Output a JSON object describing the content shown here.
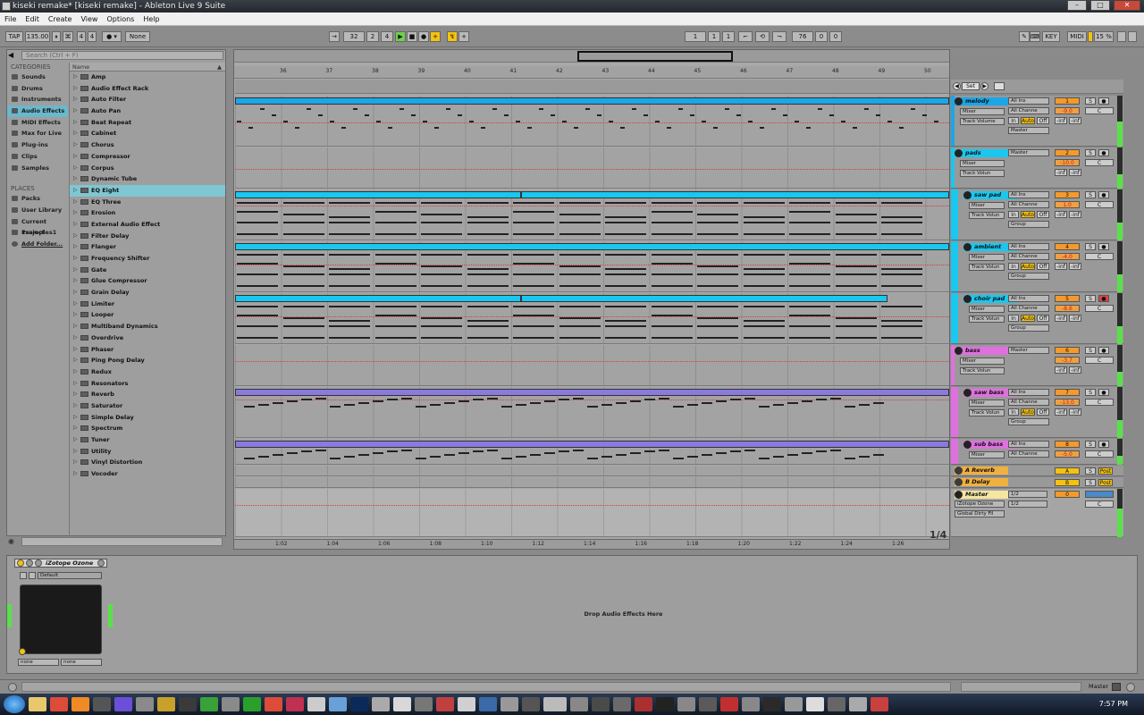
{
  "window": {
    "title": "kiseki remake*  [kiseki remake] - Ableton Live 9 Suite"
  },
  "menu": [
    "File",
    "Edit",
    "Create",
    "View",
    "Options",
    "Help"
  ],
  "transport": {
    "tap": "TAP",
    "tempo": "135.00",
    "signature_num": "4",
    "signature_den": "4",
    "quantize": "None",
    "position": [
      "32",
      "2",
      "4"
    ],
    "loop_start": [
      "1",
      "1",
      "1"
    ],
    "loop_length": [
      "76",
      "0",
      "0"
    ],
    "key_label": "KEY",
    "midi_label": "MIDI",
    "cpu": "15 %"
  },
  "browser": {
    "search_placeholder": "Search (Ctrl + F)",
    "categories_header": "CATEGORIES",
    "categories": [
      "Sounds",
      "Drums",
      "Instruments",
      "Audio Effects",
      "MIDI Effects",
      "Max for Live",
      "Plug-ins",
      "Clips",
      "Samples"
    ],
    "selected_category": "Audio Effects",
    "places_header": "PLACES",
    "places": [
      "Packs",
      "User Library",
      "Current Project",
      "1samples1",
      "Add Folder..."
    ],
    "name_header": "Name",
    "items": [
      "Amp",
      "Audio Effect Rack",
      "Auto Filter",
      "Auto Pan",
      "Beat Repeat",
      "Cabinet",
      "Chorus",
      "Compressor",
      "Corpus",
      "Dynamic Tube",
      "EQ Eight",
      "EQ Three",
      "Erosion",
      "External Audio Effect",
      "Filter Delay",
      "Flanger",
      "Frequency Shifter",
      "Gate",
      "Glue Compressor",
      "Grain Delay",
      "Limiter",
      "Looper",
      "Multiband Dynamics",
      "Overdrive",
      "Phaser",
      "Ping Pong Delay",
      "Redux",
      "Resonators",
      "Reverb",
      "Saturator",
      "Simple Delay",
      "Spectrum",
      "Tuner",
      "Utility",
      "Vinyl Distortion",
      "Vocoder"
    ],
    "selected_item": "EQ Eight"
  },
  "ruler": {
    "bars": [
      "36",
      "37",
      "38",
      "39",
      "40",
      "41",
      "42",
      "43",
      "44",
      "45",
      "46",
      "47",
      "48",
      "49",
      "50"
    ]
  },
  "timeline": {
    "times": [
      "1:02",
      "1:04",
      "1:06",
      "1:08",
      "1:10",
      "1:12",
      "1:14",
      "1:16",
      "1:18",
      "1:20",
      "1:22",
      "1:24",
      "1:26"
    ]
  },
  "page_indicator": "1/4",
  "set_label": "Set",
  "tracks": [
    {
      "name": "melody",
      "color": "#1aa6e8",
      "input": "All Ins",
      "channel": "All Channe",
      "output": "Master",
      "mixer": "Mixer",
      "param": "Track Volume",
      "num": "1",
      "vol": "-9.0",
      "pan": "C",
      "in": "In",
      "auto": "Auto",
      "off": "Off",
      "sends": [
        "-inf",
        "-inf"
      ]
    },
    {
      "name": "pads",
      "color": "#18c8f0",
      "input": "Master",
      "channel": "",
      "output": "",
      "mixer": "Mixer",
      "param": "Track Volun",
      "num": "2",
      "vol": "-10.0",
      "pan": "C",
      "in": "",
      "auto": "",
      "off": "",
      "sends": [
        "-inf",
        "-inf"
      ]
    },
    {
      "name": "saw pad",
      "color": "#18c8f0",
      "input": "All Ins",
      "channel": "All Channe",
      "output": "Group",
      "mixer": "Mixer",
      "param": "Track Volun",
      "num": "3",
      "vol": "1.0",
      "pan": "C",
      "in": "In",
      "auto": "Auto",
      "off": "Off",
      "sends": [
        "-inf",
        "-inf"
      ]
    },
    {
      "name": "ambient",
      "color": "#18c8f0",
      "input": "All Ins",
      "channel": "All Channe",
      "output": "Group",
      "mixer": "Mixer",
      "param": "Track Volun",
      "num": "4",
      "vol": "-4.0",
      "pan": "C",
      "in": "In",
      "auto": "Auto",
      "off": "Off",
      "sends": [
        "-inf",
        "-inf"
      ]
    },
    {
      "name": "choir pad",
      "color": "#18c8f0",
      "input": "All Ins",
      "channel": "All Channe",
      "output": "Group",
      "mixer": "Mixer",
      "param": "Track Volun",
      "num": "5",
      "vol": "-8.6",
      "pan": "C",
      "in": "In",
      "auto": "Auto",
      "off": "Off",
      "sends": [
        "-inf",
        "-inf"
      ]
    },
    {
      "name": "bass",
      "color": "#e070e0",
      "input": "Master",
      "channel": "",
      "output": "",
      "mixer": "Mixer",
      "param": "Track Volun",
      "num": "6",
      "vol": "-3.7",
      "pan": "C",
      "in": "",
      "auto": "",
      "off": "",
      "sends": [
        "-inf",
        "-inf"
      ]
    },
    {
      "name": "saw bass",
      "color": "#e070e0",
      "input": "All Ins",
      "channel": "All Channe",
      "output": "Group",
      "mixer": "Mixer",
      "param": "Track Volun",
      "num": "7",
      "vol": "-13.0",
      "pan": "C",
      "in": "In",
      "auto": "Auto",
      "off": "Off",
      "sends": [
        "-inf",
        "-inf"
      ]
    },
    {
      "name": "sub bass",
      "color": "#e070e0",
      "input": "All Ins",
      "channel": "All Channe",
      "output": "",
      "mixer": "Mixer",
      "param": "",
      "num": "8",
      "vol": "-5.0",
      "pan": "C",
      "in": "",
      "auto": "",
      "off": "",
      "sends": [
        "",
        ""
      ]
    }
  ],
  "returns": [
    {
      "name": "A Reverb",
      "num": "A",
      "post": "Post"
    },
    {
      "name": "B Delay",
      "num": "B",
      "post": "Post"
    }
  ],
  "master": {
    "name": "Master",
    "cue_in": "1/2",
    "cue_out": "1/2",
    "device": "iZotope Ozone",
    "param": "Global Dirty Fil",
    "num": "0",
    "pan": "C"
  },
  "device": {
    "name": "iZotope Ozone",
    "preset": "Default",
    "left_sel": "none",
    "right_sel": "none"
  },
  "dropzone": "Drop Audio Effects Here",
  "statusbar": {
    "master_label": "Master"
  },
  "clock": "7:57 PM"
}
